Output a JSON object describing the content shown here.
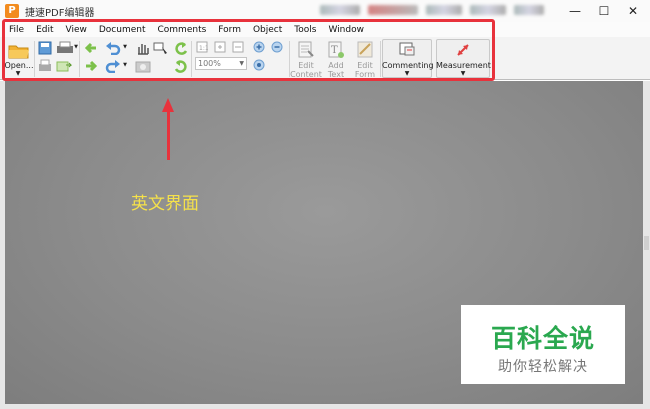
{
  "window": {
    "title": "捷速PDF编辑器",
    "logo_letter": "P",
    "controls": {
      "minimize": "—",
      "maximize": "☐",
      "close": "✕"
    }
  },
  "menubar": {
    "items": [
      "File",
      "Edit",
      "View",
      "Document",
      "Comments",
      "Form",
      "Object",
      "Tools",
      "Window"
    ]
  },
  "toolbar": {
    "open_label": "Open...",
    "zoom_value": "100%",
    "edit_content_label": "Edit Content",
    "add_text_label": "Add Text",
    "edit_form_label": "Edit Form",
    "commenting_label": "Commenting",
    "measurement_label": "Measurement"
  },
  "annotation": {
    "text": "英文界面",
    "color": "#f5e14a",
    "highlight_color": "#e8323c"
  },
  "watermark": {
    "title": "百科全说",
    "subtitle": "助你轻松解决",
    "color": "#2aa84f"
  }
}
